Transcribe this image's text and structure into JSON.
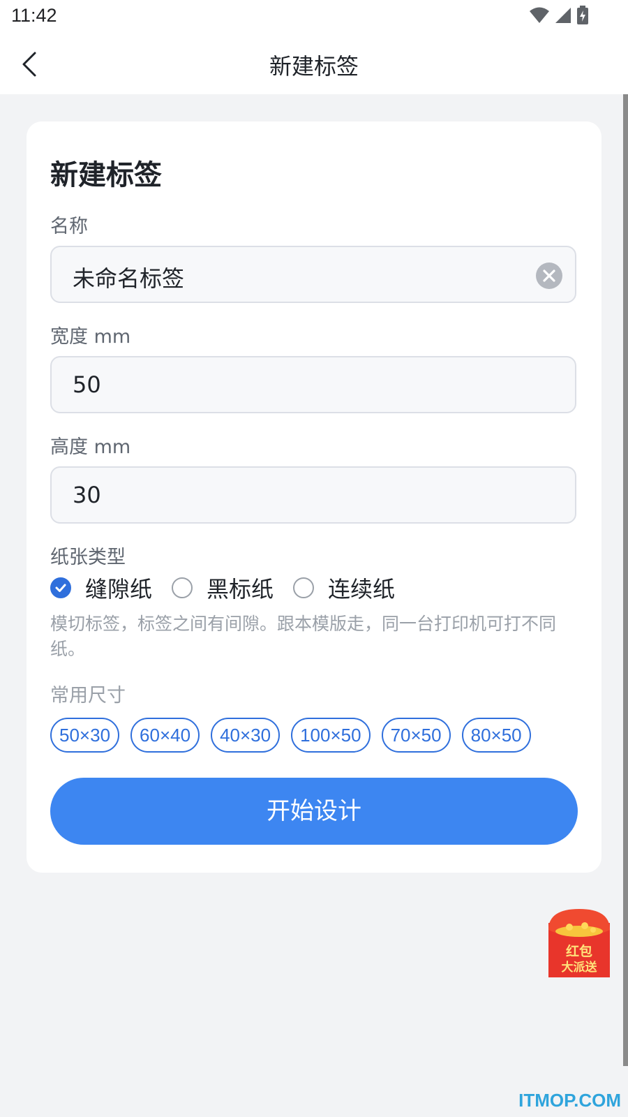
{
  "status_bar": {
    "time": "11:42",
    "icons": [
      "wifi-icon",
      "cell-signal-icon",
      "battery-charging-icon"
    ]
  },
  "nav": {
    "title": "新建标签",
    "back_icon": "chevron-left-icon"
  },
  "card": {
    "title": "新建标签",
    "name_label": "名称",
    "name_value": "未命名标签",
    "width_label": "宽度 mm",
    "width_value": "50",
    "height_label": "高度 mm",
    "height_value": "30",
    "paper_type_label": "纸张类型",
    "paper_types": [
      {
        "label": "缝隙纸",
        "checked": true
      },
      {
        "label": "黑标纸",
        "checked": false
      },
      {
        "label": "连续纸",
        "checked": false
      }
    ],
    "paper_desc": "模切标签，标签之间有间隙。跟本模版走，同一台打印机可打不同纸。",
    "common_sizes_label": "常用尺寸",
    "common_sizes": [
      "50×30",
      "60×40",
      "40×30",
      "100×50",
      "70×50",
      "80×50"
    ],
    "start_button": "开始设计"
  },
  "promo": {
    "line1": "红包",
    "line2": "大派送"
  },
  "watermark": "ITMOP.COM",
  "colors": {
    "accent": "#3d86f1",
    "chip": "#2f6fdc",
    "background": "#f2f3f5"
  }
}
